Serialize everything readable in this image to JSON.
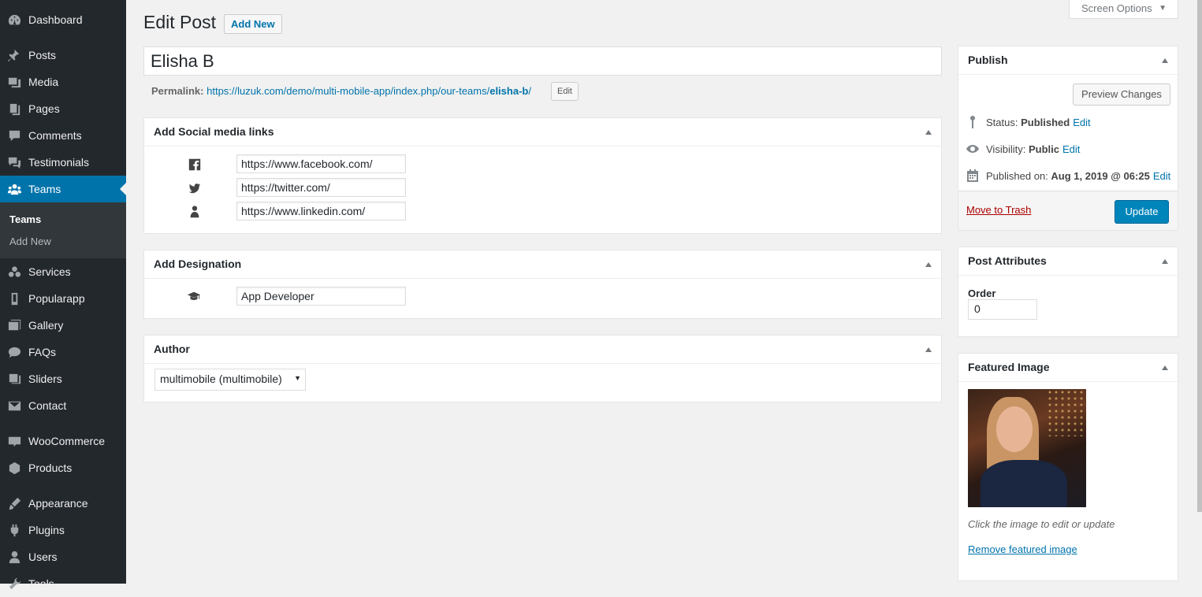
{
  "sidebar": {
    "items": [
      {
        "label": "Dashboard",
        "icon": "dashboard-icon"
      },
      {
        "label": "Posts",
        "icon": "pushpin-icon"
      },
      {
        "label": "Media",
        "icon": "media-icon"
      },
      {
        "label": "Pages",
        "icon": "pages-icon"
      },
      {
        "label": "Comments",
        "icon": "comments-icon"
      },
      {
        "label": "Testimonials",
        "icon": "testimonials-icon"
      },
      {
        "label": "Teams",
        "icon": "groups-icon"
      },
      {
        "label": "Services",
        "icon": "services-icon"
      },
      {
        "label": "Popularapp",
        "icon": "mobile-icon"
      },
      {
        "label": "Gallery",
        "icon": "gallery-icon"
      },
      {
        "label": "FAQs",
        "icon": "faq-icon"
      },
      {
        "label": "Sliders",
        "icon": "sliders-icon"
      },
      {
        "label": "Contact",
        "icon": "email-icon"
      },
      {
        "label": "WooCommerce",
        "icon": "woocommerce-icon"
      },
      {
        "label": "Products",
        "icon": "products-icon"
      },
      {
        "label": "Appearance",
        "icon": "appearance-icon"
      },
      {
        "label": "Plugins",
        "icon": "plugins-icon"
      },
      {
        "label": "Users",
        "icon": "users-icon"
      },
      {
        "label": "Tools",
        "icon": "tools-icon"
      }
    ],
    "submenu": [
      "Teams",
      "Add New"
    ],
    "active": "Teams",
    "colors": {
      "bg": "#23282d",
      "active": "#0073aa",
      "submenu_bg": "#32373c"
    }
  },
  "header": {
    "title": "Edit Post",
    "add_new": "Add New",
    "screen_options": "Screen Options"
  },
  "post": {
    "title": "Elisha B",
    "permalink_label": "Permalink:",
    "permalink_base": "https://luzuk.com/demo/multi-mobile-app/index.php/our-teams/",
    "permalink_slug": "elisha-b",
    "permalink_trailing": "/",
    "permalink_edit": "Edit"
  },
  "social": {
    "title": "Add Social media links",
    "links": [
      {
        "icon": "facebook-icon",
        "value": "https://www.facebook.com/"
      },
      {
        "icon": "twitter-icon",
        "value": "https://twitter.com/"
      },
      {
        "icon": "linkedin-icon",
        "value": "https://www.linkedin.com/"
      }
    ]
  },
  "designation": {
    "title": "Add Designation",
    "icon": "graduation-cap-icon",
    "value": "App Developer"
  },
  "author": {
    "title": "Author",
    "selected": "multimobile (multimobile)"
  },
  "publish": {
    "title": "Publish",
    "preview": "Preview Changes",
    "status_label": "Status:",
    "status_value": "Published",
    "visibility_label": "Visibility:",
    "visibility_value": "Public",
    "published_label": "Published on:",
    "published_value": "Aug 1, 2019 @ 06:25",
    "edit": "Edit",
    "trash": "Move to Trash",
    "update": "Update"
  },
  "attributes": {
    "title": "Post Attributes",
    "order_label": "Order",
    "order_value": "0"
  },
  "featured": {
    "title": "Featured Image",
    "hint": "Click the image to edit or update",
    "remove": "Remove featured image"
  }
}
